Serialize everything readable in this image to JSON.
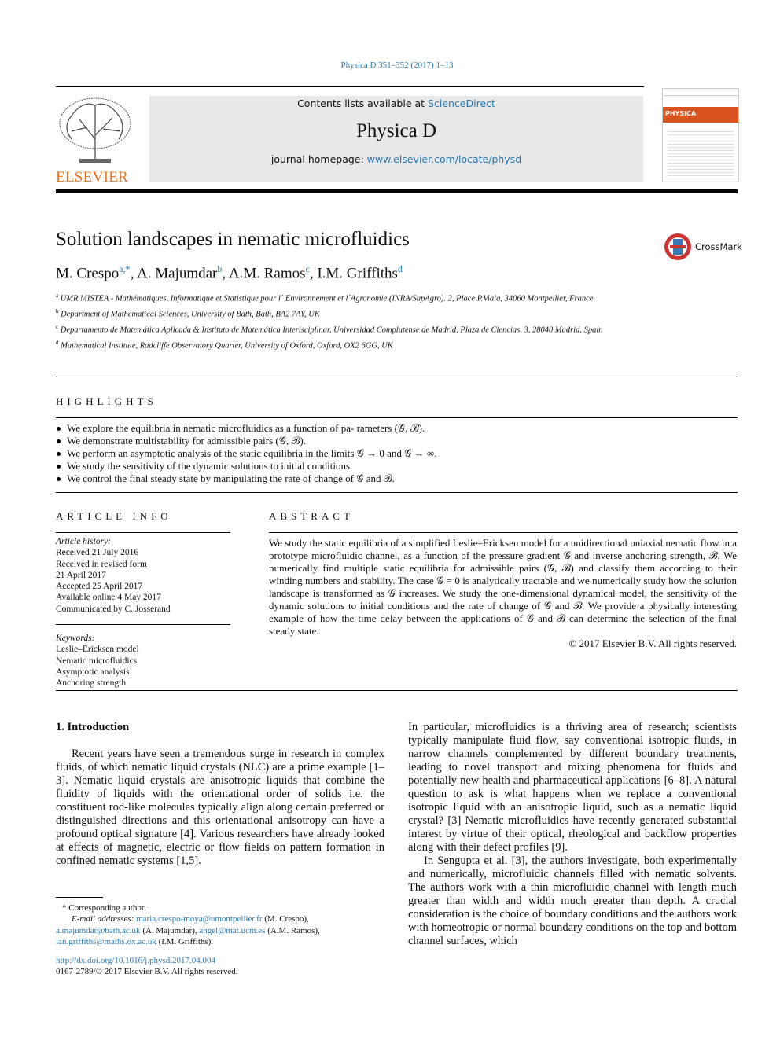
{
  "journal_ref": "Physica D 351–352 (2017) 1–13",
  "banner": {
    "contents_prefix": "Contents lists available at ",
    "contents_link": "ScienceDirect",
    "journal": "Physica D",
    "homepage_prefix": "journal homepage: ",
    "homepage_link": "www.elsevier.com/locate/physd"
  },
  "publisher": "ELSEVIER",
  "cover_title": "PHYSICA",
  "crossmark": "CrossMark",
  "title": "Solution landscapes in nematic microfluidics",
  "authors": [
    {
      "name": "M. Crespo",
      "sup": "a,*"
    },
    {
      "name": "A. Majumdar",
      "sup": "b"
    },
    {
      "name": "A.M. Ramos",
      "sup": "c"
    },
    {
      "name": "I.M. Griffiths",
      "sup": "d"
    }
  ],
  "affiliations": [
    {
      "sup": "a",
      "text": "UMR MISTEA - Mathématiques, Informatique et Statistique pour l´ Environnement et l´Agronomie (INRA/SupAgro). 2, Place P.Viala, 34060 Montpellier, France"
    },
    {
      "sup": "b",
      "text": "Department of Mathematical Sciences, University of Bath, Bath, BA2 7AY, UK"
    },
    {
      "sup": "c",
      "text": "Departamento de Matemática Aplicada & Instituto de Matemática Interisciplinar, Universidad Complutense de Madrid, Plaza de Ciencias, 3, 28040 Madrid, Spain"
    },
    {
      "sup": "d",
      "text": "Mathematical Institute, Radcliffe Observatory Quarter, University of Oxford, Oxford, OX2 6GG, UK"
    }
  ],
  "highlights": {
    "heading": "HIGHLIGHTS",
    "items": [
      "We explore the equilibria in nematic microfluidics as a function of pa- rameters (𝒢, ℬ).",
      "We demonstrate multistability for admissible pairs (𝒢, ℬ).",
      "We perform an asymptotic analysis of the static equilibria in the limits 𝒢 → 0 and 𝒢 → ∞.",
      "We study the sensitivity of the dynamic solutions to initial conditions.",
      "We control the final steady state by manipulating the rate of change of 𝒢 and ℬ."
    ]
  },
  "article_info": {
    "heading": "ARTICLE INFO",
    "history_label": "Article history:",
    "history": [
      "Received 21 July 2016",
      "Received in revised form",
      "21 April 2017",
      "Accepted 25 April 2017",
      "Available online 4 May 2017",
      "Communicated by C. Josserand"
    ],
    "keywords_label": "Keywords:",
    "keywords": [
      "Leslie–Ericksen model",
      "Nematic microfluidics",
      "Asymptotic analysis",
      "Anchoring strength"
    ]
  },
  "abstract": {
    "heading": "ABSTRACT",
    "text": "We study the static equilibria of a simplified Leslie–Ericksen model for a unidirectional uniaxial nematic flow in a prototype microfluidic channel, as a function of the pressure gradient 𝒢 and inverse anchoring strength, ℬ. We numerically find multiple static equilibria for admissible pairs (𝒢, ℬ) and classify them according to their winding numbers and stability. The case 𝒢 = 0 is analytically tractable and we numerically study how the solution landscape is transformed as 𝒢 increases. We study the one-dimensional dynamical model, the sensitivity of the dynamic solutions to initial conditions and the rate of change of 𝒢 and ℬ. We provide a physically interesting example of how the time delay between the applications of 𝒢 and ℬ can determine the selection of the final steady state.",
    "copyright": "© 2017 Elsevier B.V. All rights reserved."
  },
  "intro": {
    "heading": "1.  Introduction",
    "left": [
      "Recent years have seen a tremendous surge in research in complex fluids, of which nematic liquid crystals (NLC) are a prime example [1–3]. Nematic liquid crystals are anisotropic liquids that combine the fluidity of liquids with the orientational order of solids i.e. the constituent rod-like molecules typically align along certain preferred or distinguished directions and this orientational anisotropy can have a profound optical signature [4]. Various researchers have already looked at effects of magnetic, electric or flow fields on pattern formation in confined nematic systems [1,5]."
    ],
    "right": [
      "In particular, microfluidics is a thriving area of research; scientists typically manipulate fluid flow, say conventional isotropic fluids, in narrow channels complemented by different boundary treatments, leading to novel transport and mixing phenomena for fluids and potentially new health and pharmaceutical applications [6–8]. A natural question to ask is what happens when we replace a conventional isotropic liquid with an anisotropic liquid, such as a nematic liquid crystal? [3] Nematic microfluidics have recently generated substantial interest by virtue of their optical, rheological and backflow properties along with their defect profiles [9].",
      "In Sengupta et al. [3], the authors investigate, both experimentally and numerically, microfluidic channels filled with nematic solvents. The authors work with a thin microfluidic channel with length much greater than width and width much greater than depth. A crucial consideration is the choice of boundary conditions and the authors work with homeotropic or normal boundary conditions on the top and bottom channel surfaces, which"
    ]
  },
  "footnote": {
    "star": "*",
    "corresponding": "Corresponding author.",
    "email_label": "E-mail addresses:",
    "emails": [
      {
        "email": "maria.crespo-moya@umontpellier.fr",
        "who": "(M. Crespo),"
      },
      {
        "email": "a.majumdar@bath.ac.uk",
        "who": "(A. Majumdar),"
      },
      {
        "email": "angel@mat.ucm.es",
        "who": "(A.M. Ramos),"
      },
      {
        "email": "ian.griffiths@maths.ox.ac.uk",
        "who": "(I.M. Griffiths)."
      }
    ],
    "doi": "http://dx.doi.org/10.1016/j.physd.2017.04.004",
    "issn": "0167-2789/© 2017 Elsevier B.V. All rights reserved."
  },
  "colors": {
    "link": "#2a7ab0",
    "elsevier_orange": "#e9711c",
    "banner_bg": "#e8e8e8"
  }
}
